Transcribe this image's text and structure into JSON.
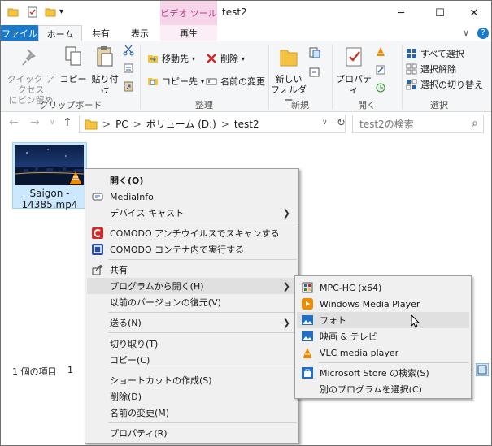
{
  "titlebar": {
    "context_tab": "ビデオ ツール",
    "title": "test2",
    "qa_dropdown": "▾"
  },
  "window_controls": {
    "minimize": "─",
    "maximize": "☐",
    "close": "✕"
  },
  "tabs": {
    "file": "ファイル",
    "home": "ホーム",
    "share": "共有",
    "view": "表示",
    "play": "再生",
    "expand": "∨",
    "help": "?"
  },
  "ribbon": {
    "clipboard": {
      "pin": "クイック アクセス\nにピン留め",
      "copy": "コピー",
      "paste": "貼り付け",
      "label": "クリップボード"
    },
    "organize": {
      "move_to": "移動先",
      "copy_to": "コピー先",
      "delete": "削除",
      "rename": "名前の変更",
      "label": "整理"
    },
    "new": {
      "new_folder": "新しい\nフォルダー",
      "label": "新規"
    },
    "open": {
      "properties": "プロパティ",
      "label": "開く"
    },
    "select": {
      "select_all": "すべて選択",
      "select_none": "選択解除",
      "invert": "選択の切り替え",
      "label": "選択"
    }
  },
  "nav": {
    "back": "←",
    "forward": "→",
    "recent": "∨",
    "up": "↑",
    "path": [
      "PC",
      "ボリューム (D:)",
      "test2"
    ],
    "sep": ">",
    "path_dropdown": "∨",
    "refresh": "↻",
    "search_placeholder": "test2の検索",
    "search_icon": "⌕"
  },
  "file": {
    "name": "Saigon -\n14385.mp4"
  },
  "statusbar": {
    "count": "1 個の項目",
    "selected": "1"
  },
  "context_menu": {
    "items": [
      {
        "label": "開く(O)",
        "bold": true
      },
      {
        "label": "MediaInfo"
      },
      {
        "label": "デバイス キャスト",
        "submenu": true
      },
      {
        "label": "COMODO アンチウイルスでスキャンする"
      },
      {
        "label": "COMODO コンテナ内で実行する"
      },
      {
        "label": "共有"
      },
      {
        "label": "プログラムから開く(H)",
        "submenu": true,
        "highlighted": true
      },
      {
        "label": "以前のバージョンの復元(V)"
      },
      {
        "label": "送る(N)",
        "submenu": true
      },
      {
        "label": "切り取り(T)"
      },
      {
        "label": "コピー(C)"
      },
      {
        "label": "ショートカットの作成(S)"
      },
      {
        "label": "削除(D)"
      },
      {
        "label": "名前の変更(M)"
      },
      {
        "label": "プロパティ(R)"
      }
    ],
    "submenu_arrow": "❯"
  },
  "open_with_menu": {
    "items": [
      {
        "label": "MPC-HC (x64)"
      },
      {
        "label": "Windows Media Player"
      },
      {
        "label": "フォト",
        "highlighted": true
      },
      {
        "label": "映画 & テレビ"
      },
      {
        "label": "VLC media player"
      },
      {
        "label": "Microsoft Store の検索(S)"
      },
      {
        "label": "別のプログラムを選択(C)"
      }
    ]
  },
  "colors": {
    "file_tab": "#1979ca",
    "context_tab_bg": "#f6d5e9",
    "context_tab_text": "#b5378a",
    "selection": "#cce8ff",
    "menu_bg": "#f0f0f0",
    "menu_highlight": "#e0e0e0"
  }
}
